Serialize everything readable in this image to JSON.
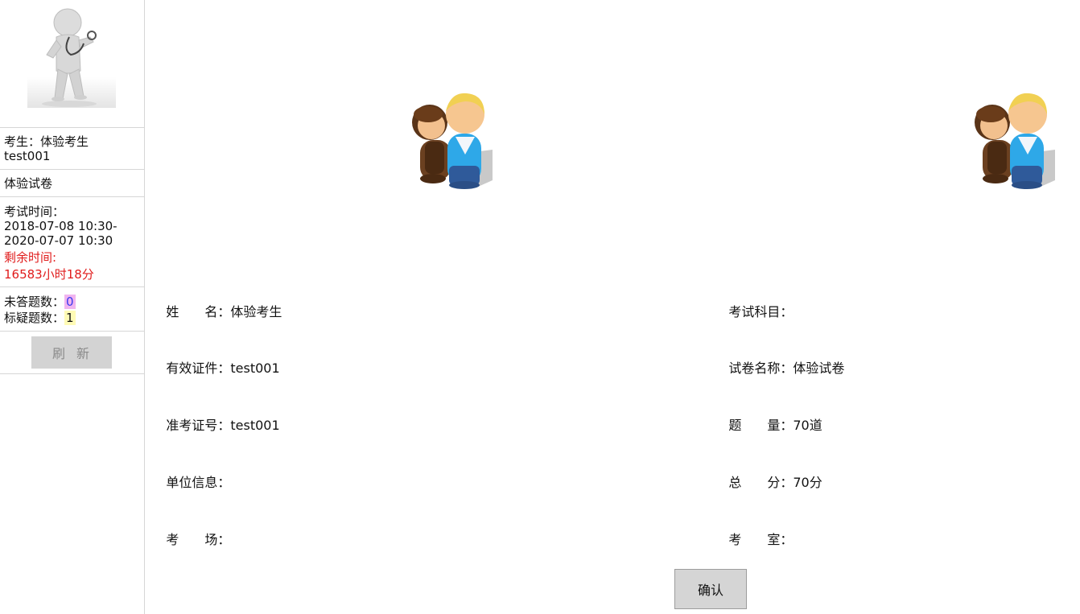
{
  "sidebar": {
    "avatar_icon": "doctor-figure-icon",
    "candidate_line": "考生：体验考生",
    "candidate_id": "test001",
    "paper_name": "体验试卷",
    "exam_time_label": "考试时间：",
    "exam_time_start": "2018-07-08 10:30-",
    "exam_time_end": "2020-07-07 10:30",
    "remaining_label": "剩余时间:",
    "remaining_value": "16583小时18分",
    "unanswered_label": "未答题数：",
    "unanswered_value": "0",
    "flagged_label": "标疑题数：",
    "flagged_value": "1",
    "refresh_label": "刷新"
  },
  "main": {
    "people_icon": "two-people-icon",
    "left_fields": [
      {
        "label": "姓　　名：",
        "value": "体验考生"
      },
      {
        "label": "有效证件：",
        "value": "test001"
      },
      {
        "label": "准考证号：",
        "value": "test001"
      },
      {
        "label": "单位信息：",
        "value": ""
      },
      {
        "label": "考　　场：",
        "value": ""
      }
    ],
    "right_fields": [
      {
        "label": "考试科目：",
        "value": ""
      },
      {
        "label": "试卷名称：",
        "value": "体验试卷"
      },
      {
        "label": "题　　量：",
        "value": "70道"
      },
      {
        "label": "总　　分：",
        "value": "70分"
      },
      {
        "label": "考　　室：",
        "value": ""
      }
    ],
    "confirm_label": "确认"
  },
  "colors": {
    "remaining": "#e01b1b",
    "unanswered_bg": "#f1b4ef",
    "flagged_bg": "#fffbb6",
    "button_bg": "#d3d3d3"
  }
}
